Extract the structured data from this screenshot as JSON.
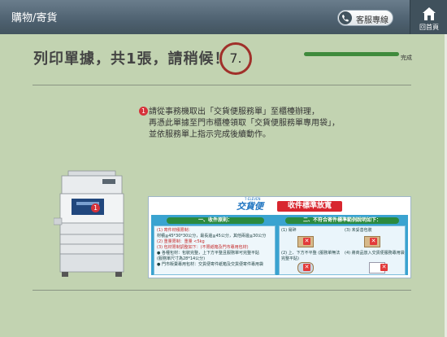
{
  "header": {
    "title": "購物/寄貨",
    "service_label": "客服專線",
    "home_label": "回首頁"
  },
  "main": {
    "heading": "列印單據，共1張，請稍候！",
    "step_number": "7.",
    "progress": {
      "fraction": 1.0,
      "label": "完成"
    },
    "instruction": {
      "badge": "1",
      "line1": "請從事務機取出「交貨便服務單」至櫃檯辦理，",
      "line2": "再憑此單據至門市櫃檯領取「交貨便服務單專用袋」，",
      "line3": "並依服務單上指示完成後續動作。"
    },
    "copier": {
      "badge": "1"
    },
    "notice": {
      "logo": "交貨便",
      "logo_small": "7-ELEVEN",
      "banner": "收件標準放寬",
      "left_header": "一、收件原則：",
      "left_lines": [
        "(1) 寄件材積限制：",
        "材積≦45*30*30公分，最長邊≦45公分，其他兩邊≦30公分",
        "(2) 重量限制：重量 <5kg",
        "(3) 包材限制調整如下：(不限紙箱及門市專用包材)",
        "● 各種包材：包裝完整，上下方平整且服務單可完整平貼",
        "(服務單尺寸為28*14公分)",
        "● 門市販賣專用包材：交貨便寄件紙箱及交貨便寄件專用袋"
      ],
      "right_header": "二、不符合寄件標準範例說明如下：",
      "right_items": [
        "(1) 易碎",
        "(2) 上、下方不平整 (服務單無法完整平貼)",
        "(3) 未妥善包裝",
        "(4) 將商品放入交貨便服務專用袋"
      ]
    }
  },
  "colors": {
    "background": "#c2d3b1",
    "header": "#4e6170",
    "accent_red": "#a0302a",
    "progress": "#3f8a3c"
  }
}
